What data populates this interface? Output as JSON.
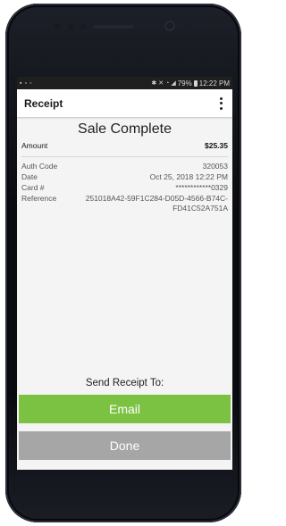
{
  "statusbar": {
    "left_icons": [
      "gallery-icon",
      "image-icon",
      "notification-icon"
    ],
    "right_icons": [
      "bluetooth-icon",
      "mute-icon",
      "alarm-icon",
      "signal-icon"
    ],
    "battery": "79%",
    "time": "12:22 PM"
  },
  "appbar": {
    "title": "Receipt"
  },
  "receipt": {
    "heading": "Sale Complete",
    "amount_label": "Amount",
    "amount_value": "$25.35",
    "auth_label": "Auth Code",
    "auth_value": "320053",
    "date_label": "Date",
    "date_value": "Oct 25, 2018 12:22 PM",
    "card_label": "Card #",
    "card_value": "************0329",
    "reference_label": "Reference",
    "reference_value": "251018A42-59F1C284-D05D-4566-B74C-FD41C52A751A"
  },
  "send": {
    "label": "Send Receipt To:",
    "email_button": "Email",
    "done_button": "Done"
  },
  "colors": {
    "email_button": "#7cc242",
    "done_button": "#a6a6a6",
    "statusbar": "#1f1f1f",
    "phone_body": "#0a0b10"
  }
}
